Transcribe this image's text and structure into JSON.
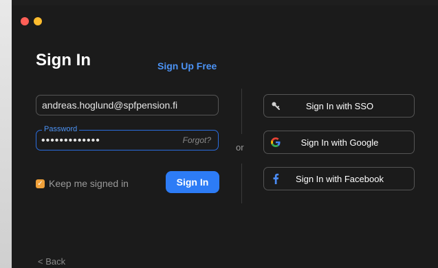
{
  "page": {
    "title": "Sign In",
    "signup_link": "Sign Up Free",
    "back_link": "< Back"
  },
  "login": {
    "email_value": "andreas.hoglund@spfpension.fi",
    "password_label": "Password",
    "password_mask": "•••••••••••••",
    "forgot_label": "Forgot?",
    "keep_signed_in_label": "Keep me signed in",
    "keep_signed_in_checked": true,
    "signin_button": "Sign In"
  },
  "divider": {
    "or_label": "or"
  },
  "alternatives": {
    "sso": {
      "label": "Sign In with SSO",
      "icon": "key-icon"
    },
    "google": {
      "label": "Sign In with Google",
      "icon": "google-icon"
    },
    "facebook": {
      "label": "Sign In with Facebook",
      "icon": "facebook-icon"
    }
  },
  "colors": {
    "accent": "#2d7cf6",
    "link": "#4c93f5",
    "checkbox": "#f0a13a",
    "background": "#1b1b1b"
  }
}
